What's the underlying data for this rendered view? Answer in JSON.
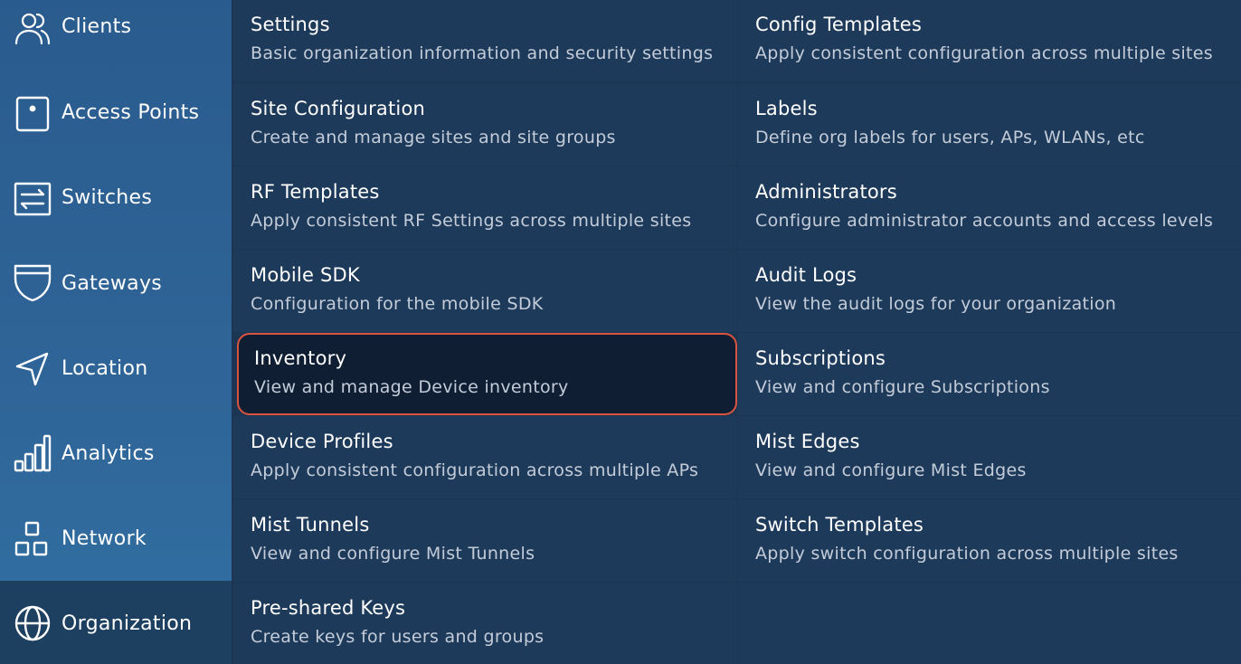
{
  "sidebar": {
    "items": [
      {
        "label": "Clients",
        "icon": "users-icon"
      },
      {
        "label": "Access Points",
        "icon": "access-point-icon"
      },
      {
        "label": "Switches",
        "icon": "switch-icon"
      },
      {
        "label": "Gateways",
        "icon": "shield-icon"
      },
      {
        "label": "Location",
        "icon": "location-arrow-icon"
      },
      {
        "label": "Analytics",
        "icon": "bar-chart-icon"
      },
      {
        "label": "Network",
        "icon": "network-icon"
      },
      {
        "label": "Organization",
        "icon": "globe-icon"
      }
    ],
    "active": "Organization"
  },
  "menu": {
    "left": [
      {
        "title": "Settings",
        "description": "Basic organization information and security settings"
      },
      {
        "title": "Site Configuration",
        "description": "Create and manage sites and site groups"
      },
      {
        "title": "RF Templates",
        "description": "Apply consistent RF Settings across multiple sites"
      },
      {
        "title": "Mobile SDK",
        "description": "Configuration for the mobile SDK"
      },
      {
        "title": "Inventory",
        "description": "View and manage Device inventory"
      },
      {
        "title": "Device Profiles",
        "description": "Apply consistent configuration across multiple APs"
      },
      {
        "title": "Mist Tunnels",
        "description": "View and configure Mist Tunnels"
      },
      {
        "title": "Pre-shared Keys",
        "description": "Create keys for users and groups"
      }
    ],
    "right": [
      {
        "title": "Config Templates",
        "description": "Apply consistent configuration across multiple sites"
      },
      {
        "title": "Labels",
        "description": "Define org labels for users, APs, WLANs, etc"
      },
      {
        "title": "Administrators",
        "description": "Configure administrator accounts and access levels"
      },
      {
        "title": "Audit Logs",
        "description": "View the audit logs for your organization"
      },
      {
        "title": "Subscriptions",
        "description": "View and configure Subscriptions"
      },
      {
        "title": "Mist Edges",
        "description": "View and configure Mist Edges"
      },
      {
        "title": "Switch Templates",
        "description": "Apply switch configuration across multiple sites"
      }
    ],
    "highlighted": "Inventory"
  },
  "colors": {
    "sidebar": "#2f6598",
    "grid_background": "#1e3a5a",
    "highlight_border": "#d9533f",
    "highlight_background": "#0f1e33"
  }
}
